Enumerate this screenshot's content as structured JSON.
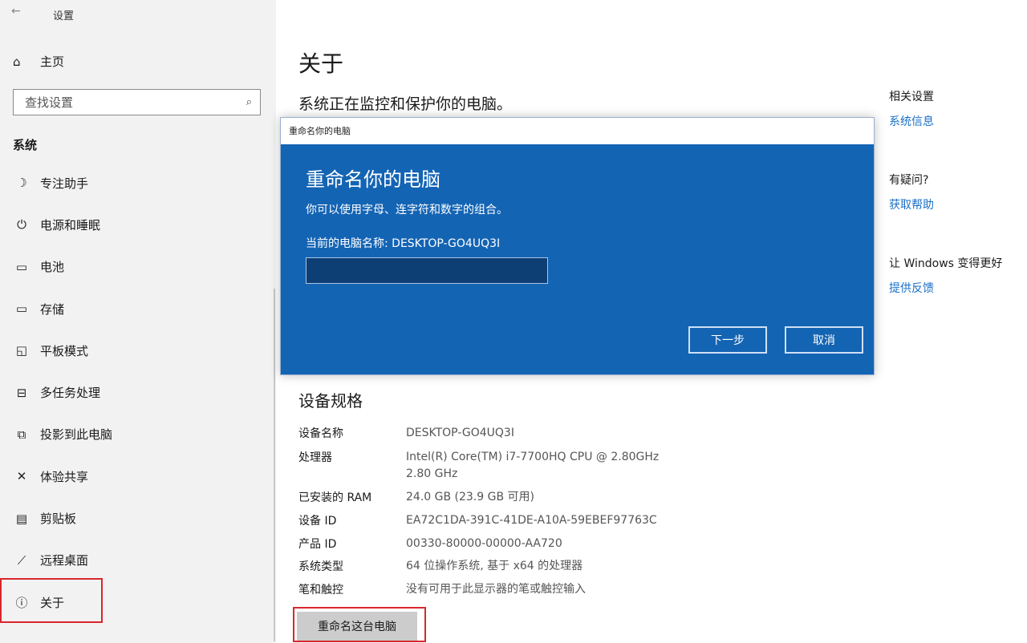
{
  "window": {
    "back_glyph": "←",
    "title": "设置"
  },
  "sidebar": {
    "home_label": "主页",
    "search_placeholder": "查找设置",
    "section": "系统",
    "items": [
      {
        "icon": "moon-icon",
        "glyph": "☽",
        "label": "专注助手"
      },
      {
        "icon": "power-icon",
        "glyph": "⏻",
        "label": "电源和睡眠"
      },
      {
        "icon": "battery-icon",
        "glyph": "▭",
        "label": "电池"
      },
      {
        "icon": "storage-icon",
        "glyph": "▭",
        "label": "存储"
      },
      {
        "icon": "tablet-icon",
        "glyph": "◱",
        "label": "平板模式"
      },
      {
        "icon": "multitask-icon",
        "glyph": "⊟",
        "label": "多任务处理"
      },
      {
        "icon": "project-icon",
        "glyph": "⧉",
        "label": "投影到此电脑"
      },
      {
        "icon": "share-icon",
        "glyph": "✕",
        "label": "体验共享"
      },
      {
        "icon": "clipboard-icon",
        "glyph": "▤",
        "label": "剪贴板"
      },
      {
        "icon": "remote-icon",
        "glyph": "⟋",
        "label": "远程桌面"
      },
      {
        "icon": "info-icon",
        "glyph": "ⓘ",
        "label": "关于"
      }
    ]
  },
  "main": {
    "title": "关于",
    "subtitle": "系统正在监控和保护你的电脑。",
    "related": {
      "heading": "相关设置",
      "link": "系统信息",
      "question": "有疑问?",
      "help_link": "获取帮助",
      "improve": "让 Windows 变得更好",
      "feedback_link": "提供反馈"
    },
    "spec_title": "设备规格",
    "specs": [
      {
        "label": "设备名称",
        "value": "DESKTOP-GO4UQ3I"
      },
      {
        "label": "处理器",
        "value": "Intel(R) Core(TM) i7-7700HQ CPU @ 2.80GHz",
        "value2": "2.80 GHz"
      },
      {
        "label": "已安装的 RAM",
        "value": "24.0 GB (23.9 GB 可用)"
      },
      {
        "label": "设备 ID",
        "value": "EA72C1DA-391C-41DE-A10A-59EBEF97763C"
      },
      {
        "label": "产品 ID",
        "value": "00330-80000-00000-AA720"
      },
      {
        "label": "系统类型",
        "value": "64 位操作系统, 基于 x64 的处理器"
      },
      {
        "label": "笔和触控",
        "value": "没有可用于此显示器的笔或触控输入"
      }
    ],
    "rename_button": "重命名这台电脑"
  },
  "dialog": {
    "bar_title": "重命名你的电脑",
    "title": "重命名你的电脑",
    "hint": "你可以使用字母、连字符和数字的组合。",
    "current": "当前的电脑名称: DESKTOP-GO4UQ3I",
    "input_value": "",
    "next": "下一步",
    "cancel": "取消"
  },
  "colors": {
    "dialog_blue": "#1464b4",
    "link_blue": "#1a6fc7",
    "highlight_red": "#d9262c"
  }
}
